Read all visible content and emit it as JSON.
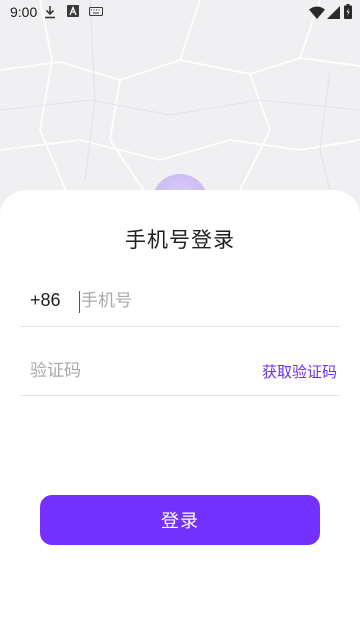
{
  "status_bar": {
    "time": "9:00",
    "icons": [
      "download-icon",
      "font-a-icon",
      "keyboard-icon",
      "wifi-icon",
      "signal-icon",
      "battery-icon"
    ]
  },
  "login": {
    "title": "手机号登录",
    "country_code": "+86",
    "phone_placeholder": "手机号",
    "code_placeholder": "验证码",
    "get_code_label": "获取验证码",
    "submit_label": "登录"
  },
  "colors": {
    "accent": "#7331ff",
    "link": "#6b2ff0",
    "divider": "#e4e4e6"
  }
}
